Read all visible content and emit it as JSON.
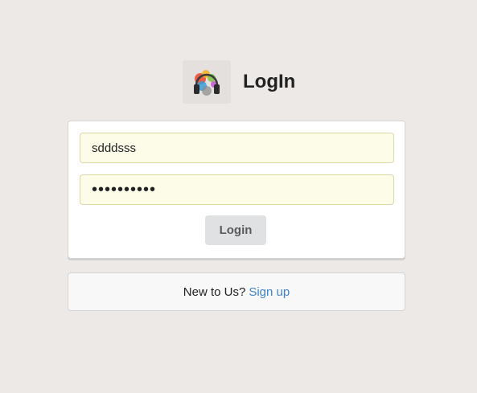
{
  "header": {
    "logo_icon": "headphones-splash-logo-icon",
    "title": "LogIn"
  },
  "login_form": {
    "username_value": "sdddsss",
    "password_value": "••••••••••",
    "submit_label": "Login"
  },
  "signup": {
    "prompt": "New to Us?",
    "link_label": "Sign up"
  },
  "colors": {
    "page_background": "#ede9e7",
    "field_background": "#fcfce9",
    "link": "#4183c4",
    "button_background": "#e0e1e2"
  }
}
